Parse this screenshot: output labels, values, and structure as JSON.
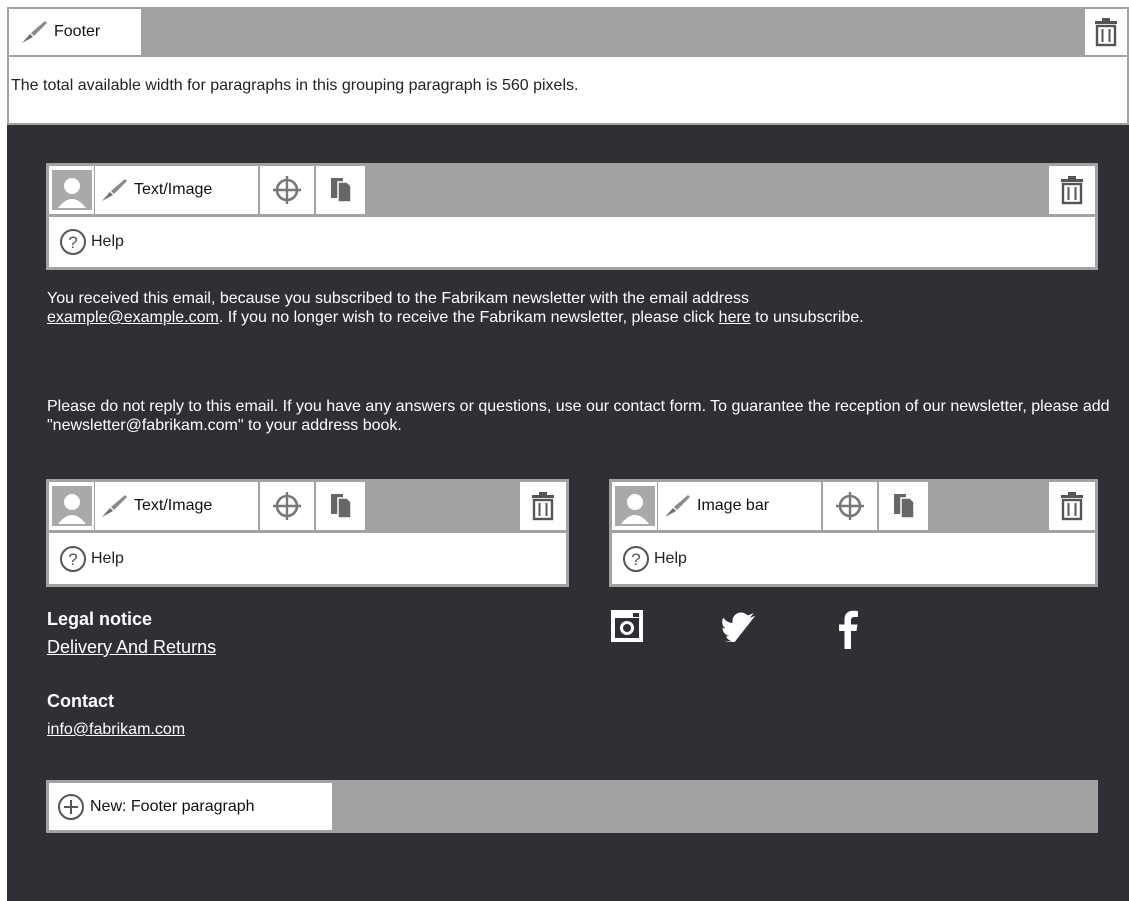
{
  "footer_bar": {
    "label": "Footer",
    "info": "The total available width for paragraphs in this grouping paragraph is 560 pixels."
  },
  "block_top": {
    "label": "Text/Image",
    "help": "Help"
  },
  "notice": {
    "p1_a": "You received this email, because you subscribed to the Fabrikam newsletter with the email address",
    "p1_link": "example@example.com",
    "p1_b": ". If you no longer wish to receive the Fabrikam newsletter, please click ",
    "p1_here": "here",
    "p1_c": " to unsubscribe.",
    "p2": "Please do not reply to this email. If you have any answers or questions, use our contact form. To guarantee the reception of our newsletter, please add \"newsletter@fabrikam.com\" to your address book."
  },
  "block_left": {
    "label": "Text/Image",
    "help": "Help"
  },
  "block_right": {
    "label": "Image bar",
    "help": "Help"
  },
  "legal": {
    "heading": "Legal notice",
    "link": "Delivery And Returns"
  },
  "contact": {
    "heading": "Contact",
    "email": "info@fabrikam.com"
  },
  "social": [
    "instagram-icon",
    "twitter-icon",
    "facebook-icon"
  ],
  "new_paragraph": {
    "label": "New: Footer paragraph"
  },
  "colors": {
    "dark_bg": "#2e3035",
    "bar_gray": "#a2a2a2"
  }
}
